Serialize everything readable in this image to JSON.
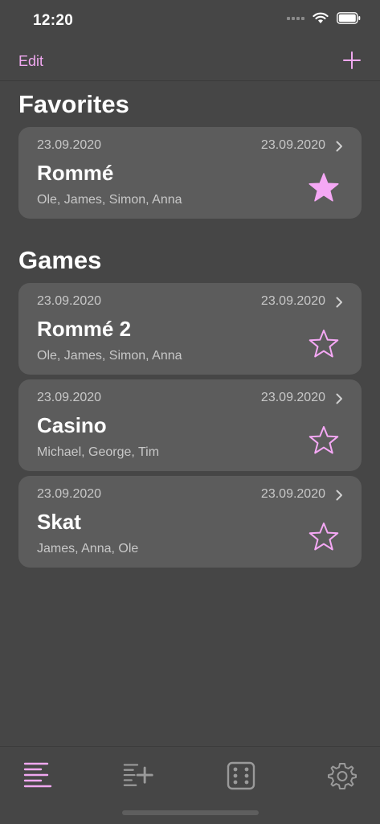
{
  "status_bar": {
    "time": "12:20"
  },
  "nav": {
    "edit_label": "Edit",
    "add_icon": "plus-icon"
  },
  "colors": {
    "accent": "#f0a8f0",
    "background": "#464646",
    "card": "#5c5c5c",
    "secondary_text": "#c8c8c8"
  },
  "favorites": {
    "title": "Favorites",
    "items": [
      {
        "date_start": "23.09.2020",
        "date_end": "23.09.2020",
        "name": "Rommé",
        "players": "Ole, James, Simon, Anna",
        "favorite": true
      }
    ]
  },
  "games": {
    "title": "Games",
    "items": [
      {
        "date_start": "23.09.2020",
        "date_end": "23.09.2020",
        "name": "Rommé 2",
        "players": "Ole, James, Simon, Anna",
        "favorite": false
      },
      {
        "date_start": "23.09.2020",
        "date_end": "23.09.2020",
        "name": "Casino",
        "players": "Michael, George, Tim",
        "favorite": false
      },
      {
        "date_start": "23.09.2020",
        "date_end": "23.09.2020",
        "name": "Skat",
        "players": "James, Anna, Ole",
        "favorite": false
      }
    ]
  },
  "tab_bar": {
    "tabs": [
      {
        "icon": "list-icon",
        "selected": true
      },
      {
        "icon": "list-add-icon",
        "selected": false
      },
      {
        "icon": "dice-icon",
        "selected": false
      },
      {
        "icon": "gear-icon",
        "selected": false
      }
    ]
  }
}
